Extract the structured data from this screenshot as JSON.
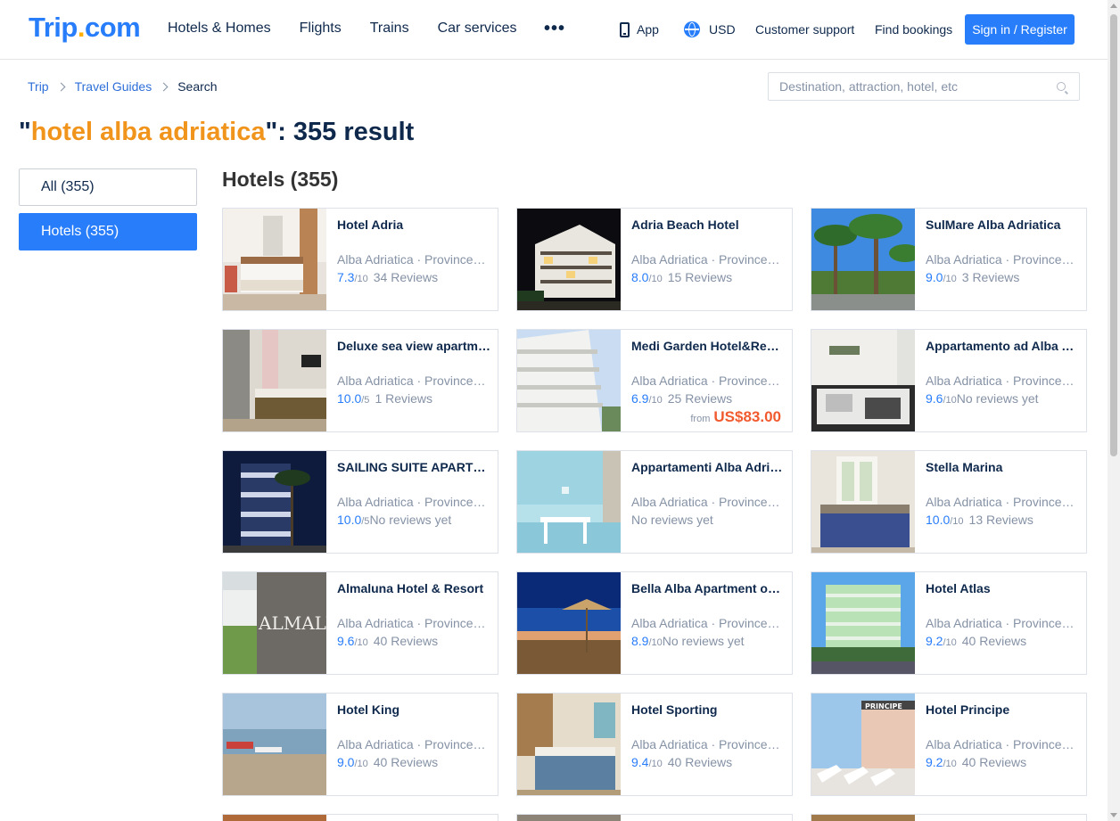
{
  "header": {
    "logo_main": "Trip",
    "logo_dot": ".",
    "logo_tld": "com",
    "nav": [
      "Hotels & Homes",
      "Flights",
      "Trains",
      "Car services"
    ],
    "more_label": "•••",
    "app_label": "App",
    "currency_label": "USD",
    "support_label": "Customer support",
    "bookings_label": "Find bookings",
    "signin_label": "Sign in / Register"
  },
  "breadcrumb": {
    "items": [
      "Trip",
      "Travel Guides",
      "Search"
    ]
  },
  "search": {
    "placeholder": "Destination, attraction, hotel, etc"
  },
  "results": {
    "quote_open": "\"",
    "query": "hotel alba adriatica",
    "suffix": "\": 355 result"
  },
  "filters": {
    "all_label": "All (355)",
    "hotels_label": "Hotels (355)"
  },
  "section": {
    "title": "Hotels (355)"
  },
  "hotels": [
    {
      "name": "Hotel Adria",
      "location": "Alba Adriatica · Province of Teramo",
      "score": "7.3",
      "out_of": "/10",
      "reviews": "34 Reviews",
      "price_from": "",
      "price": ""
    },
    {
      "name": "Adria Beach Hotel",
      "location": "Alba Adriatica · Province of Teramo",
      "score": "8.0",
      "out_of": "/10",
      "reviews": "15 Reviews",
      "price_from": "",
      "price": ""
    },
    {
      "name": "SulMare Alba Adriatica",
      "location": "Alba Adriatica · Province of Teramo",
      "score": "9.0",
      "out_of": "/10",
      "reviews": "3 Reviews",
      "price_from": "",
      "price": ""
    },
    {
      "name": "Deluxe sea view apartment",
      "location": "Alba Adriatica · Province of Teramo",
      "score": "10.0",
      "out_of": "/5",
      "reviews": "1 Reviews",
      "price_from": "",
      "price": ""
    },
    {
      "name": "Medi Garden Hotel&Resort",
      "location": "Alba Adriatica · Province of Teramo",
      "score": "6.9",
      "out_of": "/10",
      "reviews": "25 Reviews",
      "price_from": "from",
      "price": "US$83.00"
    },
    {
      "name": "Appartamento ad Alba Adriatica",
      "location": "Alba Adriatica · Province of Teramo",
      "score": "9.6",
      "out_of": "/10",
      "reviews": "No reviews yet",
      "price_from": "",
      "price": ""
    },
    {
      "name": "SAILING SUITE APARTMENTS",
      "location": "Alba Adriatica · Province of Teramo",
      "score": "10.0",
      "out_of": "/5",
      "reviews": "No reviews yet",
      "price_from": "",
      "price": ""
    },
    {
      "name": "Appartamenti Alba Adriatica",
      "location": "Alba Adriatica · Province of Teramo",
      "score": "",
      "out_of": "",
      "reviews": "No reviews yet",
      "price_from": "",
      "price": ""
    },
    {
      "name": "Stella Marina",
      "location": "Alba Adriatica · Province of Teramo",
      "score": "10.0",
      "out_of": "/10",
      "reviews": "13 Reviews",
      "price_from": "",
      "price": ""
    },
    {
      "name": "Almaluna Hotel & Resort",
      "location": "Alba Adriatica · Province of Teramo",
      "score": "9.6",
      "out_of": "/10",
      "reviews": "40 Reviews",
      "price_from": "",
      "price": ""
    },
    {
      "name": "Bella Alba Apartment on the beach",
      "location": "Alba Adriatica · Province of Teramo",
      "score": "8.9",
      "out_of": "/10",
      "reviews": "No reviews yet",
      "price_from": "",
      "price": ""
    },
    {
      "name": "Hotel Atlas",
      "location": "Alba Adriatica · Province of Teramo",
      "score": "9.2",
      "out_of": "/10",
      "reviews": "40 Reviews",
      "price_from": "",
      "price": ""
    },
    {
      "name": "Hotel King",
      "location": "Alba Adriatica · Province of Teramo",
      "score": "9.0",
      "out_of": "/10",
      "reviews": "40 Reviews",
      "price_from": "",
      "price": ""
    },
    {
      "name": "Hotel Sporting",
      "location": "Alba Adriatica · Province of Teramo",
      "score": "9.4",
      "out_of": "/10",
      "reviews": "40 Reviews",
      "price_from": "",
      "price": ""
    },
    {
      "name": "Hotel Principe",
      "location": "Alba Adriatica · Province of Teramo",
      "score": "9.2",
      "out_of": "/10",
      "reviews": "40 Reviews",
      "price_from": "",
      "price": ""
    }
  ],
  "photo_text": {
    "almaluna_sign": "ALMALUN",
    "principe_sign": "PRINCIPE"
  },
  "colors": {
    "brand_blue": "#287dfa",
    "query_orange": "#f0941c",
    "price_red": "#f15a2e",
    "text_dark": "#0f294d",
    "text_gray": "#8592a6"
  }
}
